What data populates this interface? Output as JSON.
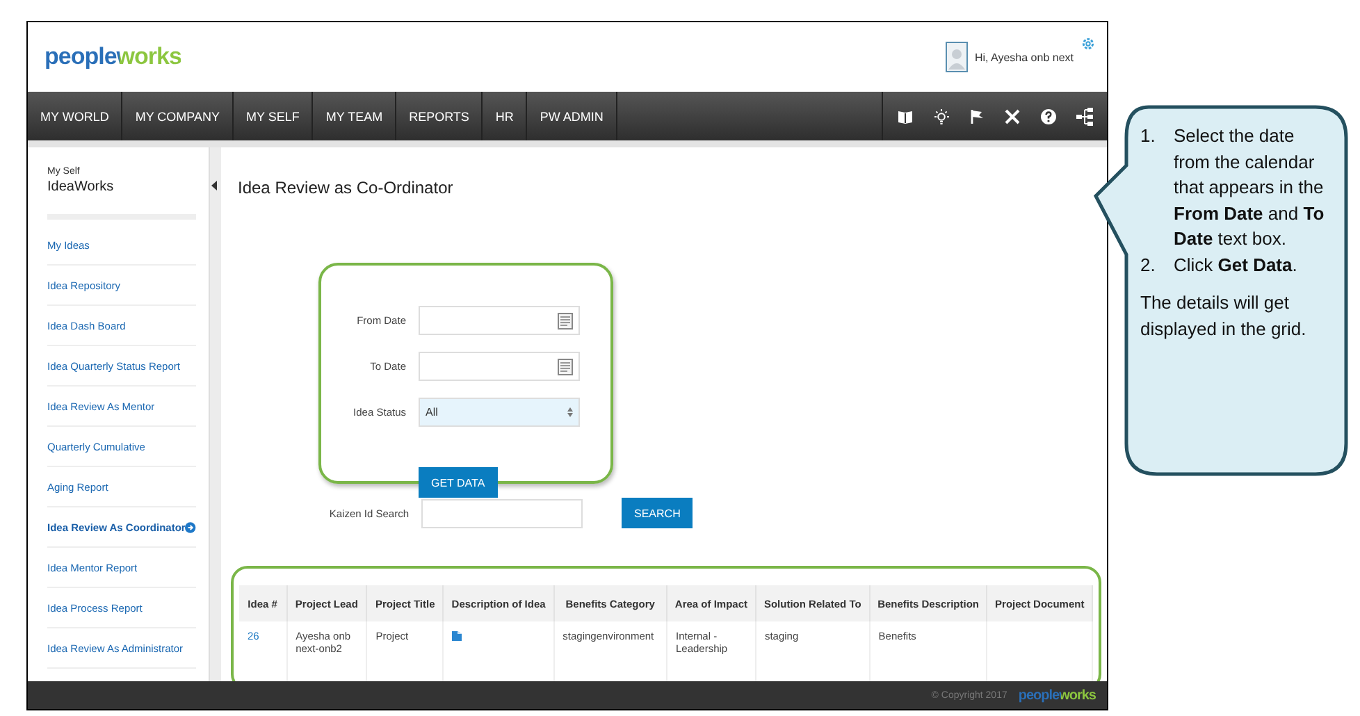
{
  "header": {
    "logo": "peopleworks",
    "greeting": "Hi, Ayesha onb next"
  },
  "nav": {
    "items": [
      "MY WORLD",
      "MY COMPANY",
      "MY SELF",
      "MY TEAM",
      "REPORTS",
      "HR",
      "PW ADMIN"
    ]
  },
  "sidebar": {
    "section": "My Self",
    "title": "IdeaWorks",
    "items": [
      {
        "label": "My Ideas",
        "selected": false
      },
      {
        "label": "Idea Repository",
        "selected": false
      },
      {
        "label": "Idea Dash Board",
        "selected": false
      },
      {
        "label": "Idea Quarterly Status Report",
        "selected": false
      },
      {
        "label": "Idea Review As Mentor",
        "selected": false
      },
      {
        "label": "Quarterly Cumulative",
        "selected": false
      },
      {
        "label": "Aging Report",
        "selected": false
      },
      {
        "label": "Idea Review As Coordinator",
        "selected": true
      },
      {
        "label": "Idea Mentor Report",
        "selected": false
      },
      {
        "label": "Idea Process Report",
        "selected": false
      },
      {
        "label": "Idea Review As Administrator",
        "selected": false
      }
    ]
  },
  "page_title": "Idea Review as Co-Ordinator",
  "form": {
    "from_date": {
      "label": "From Date"
    },
    "to_date": {
      "label": "To Date"
    },
    "idea_status": {
      "label": "Idea Status",
      "value": "All"
    },
    "get_data_button": "GET DATA",
    "kaizen": {
      "label": "Kaizen Id Search"
    },
    "search_button": "SEARCH"
  },
  "table": {
    "columns": [
      "Idea #",
      "Project Lead",
      "Project Title",
      "Description of Idea",
      "Benefits Category",
      "Area of Impact",
      "Solution Related To",
      "Benefits Description",
      "Project Document"
    ],
    "rows": [
      {
        "cells": [
          {
            "kind": "link",
            "text": "26"
          },
          {
            "kind": "text",
            "text": "Ayesha onb next-onb2"
          },
          {
            "kind": "text",
            "text": "Project"
          },
          {
            "kind": "icon"
          },
          {
            "kind": "text",
            "text": "stagingenvironment"
          },
          {
            "kind": "text",
            "text": "Internal - Leadership"
          },
          {
            "kind": "text",
            "text": "staging"
          },
          {
            "kind": "text",
            "text": "Benefits"
          },
          {
            "kind": "blank"
          }
        ]
      }
    ]
  },
  "footer": {
    "copyright": "© Copyright 2017",
    "logo": "peopleworks"
  },
  "callout": {
    "steps": [
      {
        "number": "1.",
        "text": "Select the date from the calendar that appears in the **From Date** and **To Date** text box."
      },
      {
        "number": "2.",
        "text": "Click **Get Data**."
      }
    ],
    "note": "The details  will get displayed in the grid."
  }
}
